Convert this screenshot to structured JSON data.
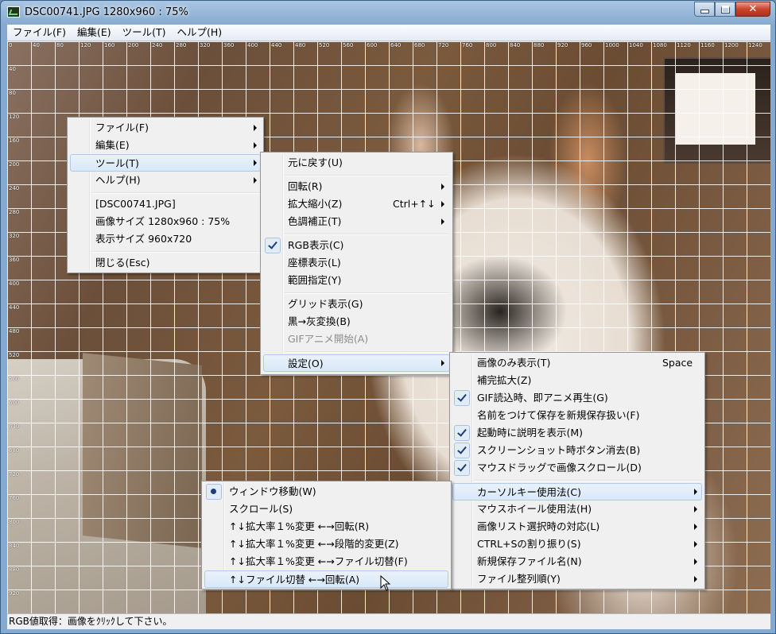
{
  "window": {
    "title": "DSC00741.JPG  1280x960 : 75%",
    "close_symbol": "✕"
  },
  "menubar": [
    "ファイル(F)",
    "編集(E)",
    "ツール(T)",
    "ヘルプ(H)"
  ],
  "ruler_x": [
    "0",
    "40",
    "80",
    "120",
    "160",
    "200",
    "240",
    "280",
    "320",
    "360",
    "400",
    "440",
    "480",
    "520",
    "560",
    "600",
    "640",
    "680",
    "720",
    "760",
    "800",
    "840",
    "880",
    "920",
    "960",
    "1000",
    "1040",
    "1080",
    "1120",
    "1160",
    "1200",
    "1240"
  ],
  "ruler_y": [
    "40",
    "80",
    "120",
    "160",
    "200",
    "240",
    "280",
    "320",
    "360",
    "400",
    "440",
    "480",
    "520",
    "560",
    "600",
    "640",
    "680",
    "720",
    "760",
    "800",
    "840",
    "880",
    "920"
  ],
  "context_menu": {
    "items": [
      "ファイル(F)",
      "編集(E)",
      "ツール(T)",
      "ヘルプ(H)"
    ],
    "info": [
      "[DSC00741.JPG]",
      "画像サイズ 1280x960 : 75%",
      "表示サイズ 960x720"
    ],
    "close": "閉じる(Esc)"
  },
  "tools_menu": {
    "undo": "元に戻す(U)",
    "rotate": "回転(R)",
    "zoom": "拡大縮小(Z)",
    "zoom_shortcut": "Ctrl+↑↓",
    "color": "色調補正(T)",
    "rgb": "RGB表示(C)",
    "coord": "座標表示(L)",
    "range": "範囲指定(Y)",
    "grid": "グリッド表示(G)",
    "gray": "黒→灰変換(B)",
    "gif": "GIFアニメ開始(A)",
    "settings": "設定(O)"
  },
  "settings_menu": {
    "image_only": "画像のみ表示(T)",
    "image_only_shortcut": "Space",
    "interp": "補完拡大(Z)",
    "gif_anim": "GIF読込時、即アニメ再生(G)",
    "save_new": "名前をつけて保存を新規保存扱い(F)",
    "startup_help": "起動時に説明を表示(M)",
    "screenshot": "スクリーンショット時ボタン消去(B)",
    "drag_scroll": "マウスドラッグで画像スクロール(D)",
    "cursor_key": "カーソルキー使用法(C)",
    "wheel": "マウスホイール使用法(H)",
    "list_select": "画像リスト選択時の対応(L)",
    "ctrl_s": "CTRL+Sの割り振り(S)",
    "new_filename": "新規保存ファイル名(N)",
    "sort_order": "ファイル整列順(Y)"
  },
  "cursor_menu": {
    "move": "ウィンドウ移動(W)",
    "scroll": "スクロール(S)",
    "opt1": "↑↓拡大率１%変更 ←→回転(R)",
    "opt2": "↑↓拡大率１%変更 ←→段階的変更(Z)",
    "opt3": "↑↓拡大率１%変更 ←→ファイル切替(F)",
    "opt4": "↑↓ファイル切替 ←→回転(A)"
  },
  "status": "RGB値取得：画像をｸﾘｯｸして下さい。",
  "colors": {
    "highlight": "#d9e8f8",
    "check": "#1c3e7a",
    "close_button": "#c9452a"
  }
}
